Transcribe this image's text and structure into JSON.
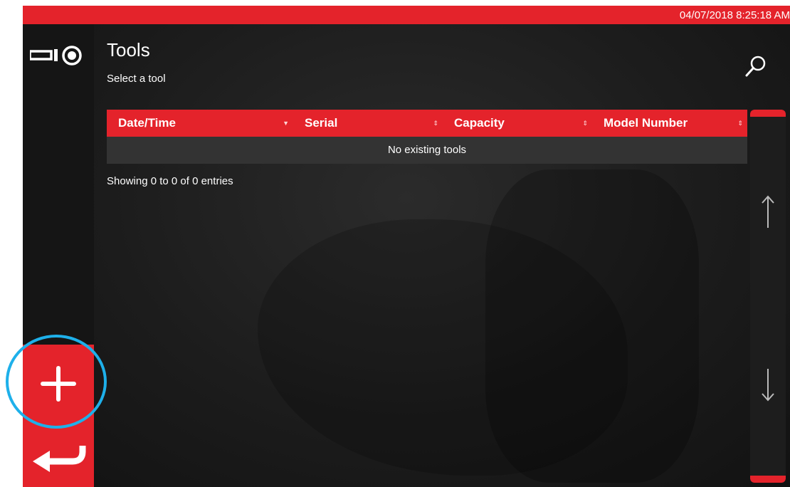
{
  "status_bar": {
    "datetime": "04/07/2018 8:25:18 AM"
  },
  "header": {
    "title": "Tools",
    "subtitle": "Select a tool",
    "search_icon": "search-icon",
    "logo_icon": "tool-logo-icon"
  },
  "table": {
    "columns": [
      {
        "label": "Date/Time",
        "sort_icon": "sort-desc-icon"
      },
      {
        "label": "Serial",
        "sort_icon": "sort-both-icon"
      },
      {
        "label": "Capacity",
        "sort_icon": "sort-both-icon"
      },
      {
        "label": "Model Number",
        "sort_icon": "sort-both-icon"
      }
    ],
    "empty_message": "No existing tools",
    "info": "Showing 0 to 0 of 0 entries"
  },
  "sidebar": {
    "add_icon": "plus-icon",
    "back_icon": "return-arrow-icon"
  },
  "scroller": {
    "up_icon": "arrow-up-icon",
    "down_icon": "arrow-down-icon"
  },
  "colors": {
    "accent": "#e4232b",
    "highlight": "#1eb0ea",
    "background": "#1c1c1c",
    "row_background": "#333333"
  }
}
